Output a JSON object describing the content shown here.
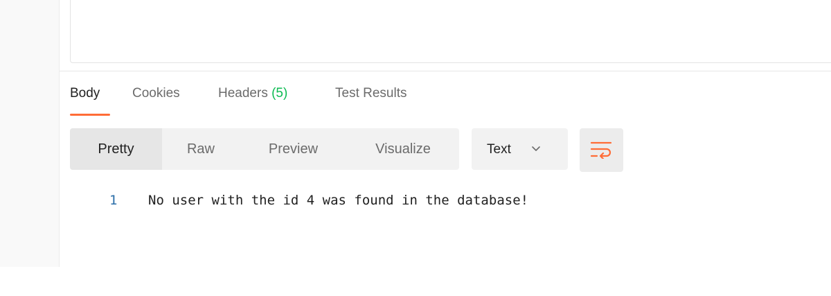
{
  "response_tabs": [
    {
      "label": "Body"
    },
    {
      "label": "Cookies"
    },
    {
      "label": "Headers",
      "count": "(5)"
    },
    {
      "label": "Test Results"
    }
  ],
  "view_modes": [
    "Pretty",
    "Raw",
    "Preview",
    "Visualize"
  ],
  "active_view": "Pretty",
  "format_select": {
    "selected": "Text"
  },
  "wrap_icon": "word-wrap-icon",
  "response_body": [
    {
      "line": "1",
      "text": "No user with the id 4 was found in the database!"
    }
  ],
  "colors": {
    "accent": "#ff6c37",
    "count_green": "#0cbb52",
    "line_number": "#2b6ea8"
  }
}
